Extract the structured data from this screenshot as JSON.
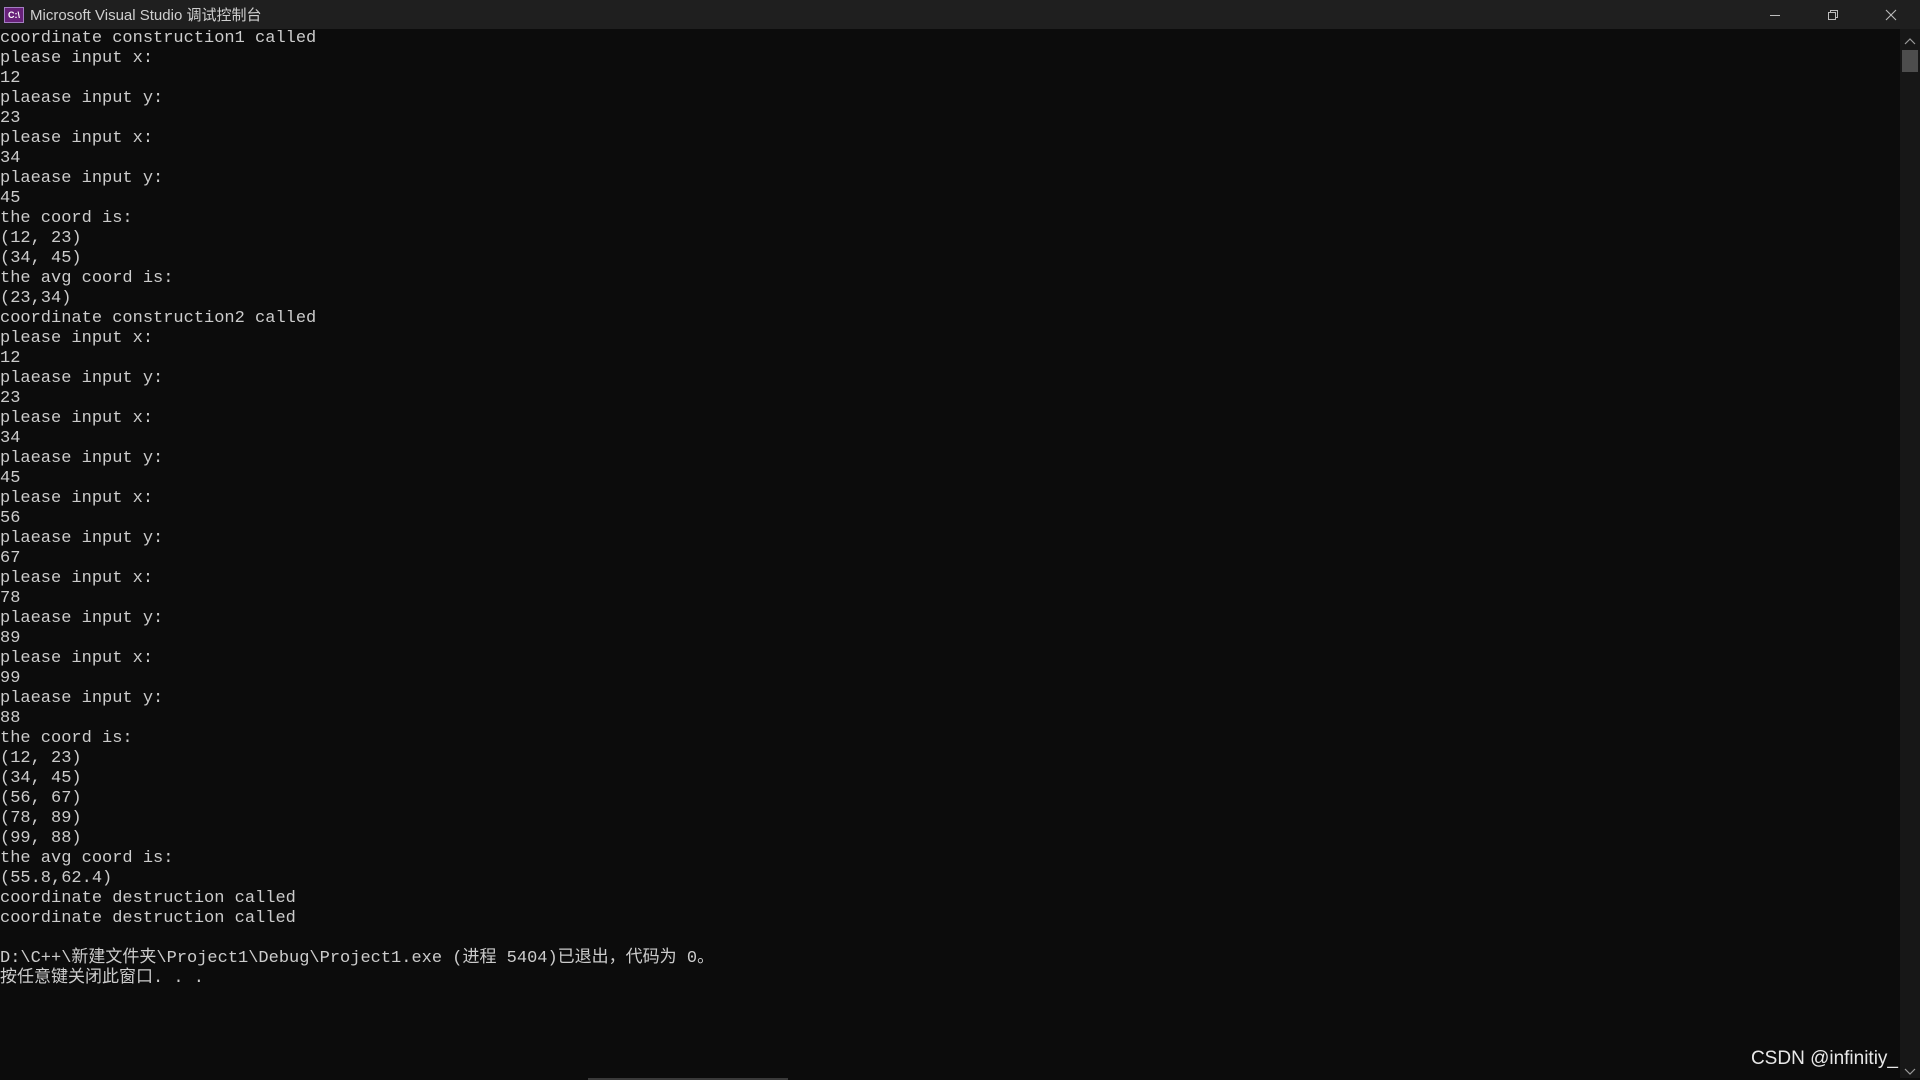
{
  "window": {
    "title": "Microsoft Visual Studio 调试控制台",
    "icon_label": "C:\\",
    "icon": "console-app-icon"
  },
  "caption_buttons": {
    "minimize_icon": "minimize-icon",
    "restore_icon": "restore-icon",
    "close_icon": "close-icon"
  },
  "console": {
    "lines": [
      "coordinate construction1 called",
      "please input x:",
      "12",
      "plaease input y:",
      "23",
      "please input x:",
      "34",
      "plaease input y:",
      "45",
      "the coord is:",
      "(12, 23)",
      "(34, 45)",
      "the avg coord is:",
      "(23,34)",
      "coordinate construction2 called",
      "please input x:",
      "12",
      "plaease input y:",
      "23",
      "please input x:",
      "34",
      "plaease input y:",
      "45",
      "please input x:",
      "56",
      "plaease input y:",
      "67",
      "please input x:",
      "78",
      "plaease input y:",
      "89",
      "please input x:",
      "99",
      "plaease input y:",
      "88",
      "the coord is:",
      "(12, 23)",
      "(34, 45)",
      "(56, 67)",
      "(78, 89)",
      "(99, 88)",
      "the avg coord is:",
      "(55.8,62.4)",
      "coordinate destruction called",
      "coordinate destruction called",
      "",
      "D:\\C++\\新建文件夹\\Project1\\Debug\\Project1.exe (进程 5404)已退出，代码为 0。",
      "按任意键关闭此窗口. . ."
    ]
  },
  "watermark": {
    "text": "CSDN @infinitiy_"
  },
  "colors": {
    "background": "#0c0c0c",
    "text": "#cccccc",
    "titlebar": "#1f1f1f"
  }
}
